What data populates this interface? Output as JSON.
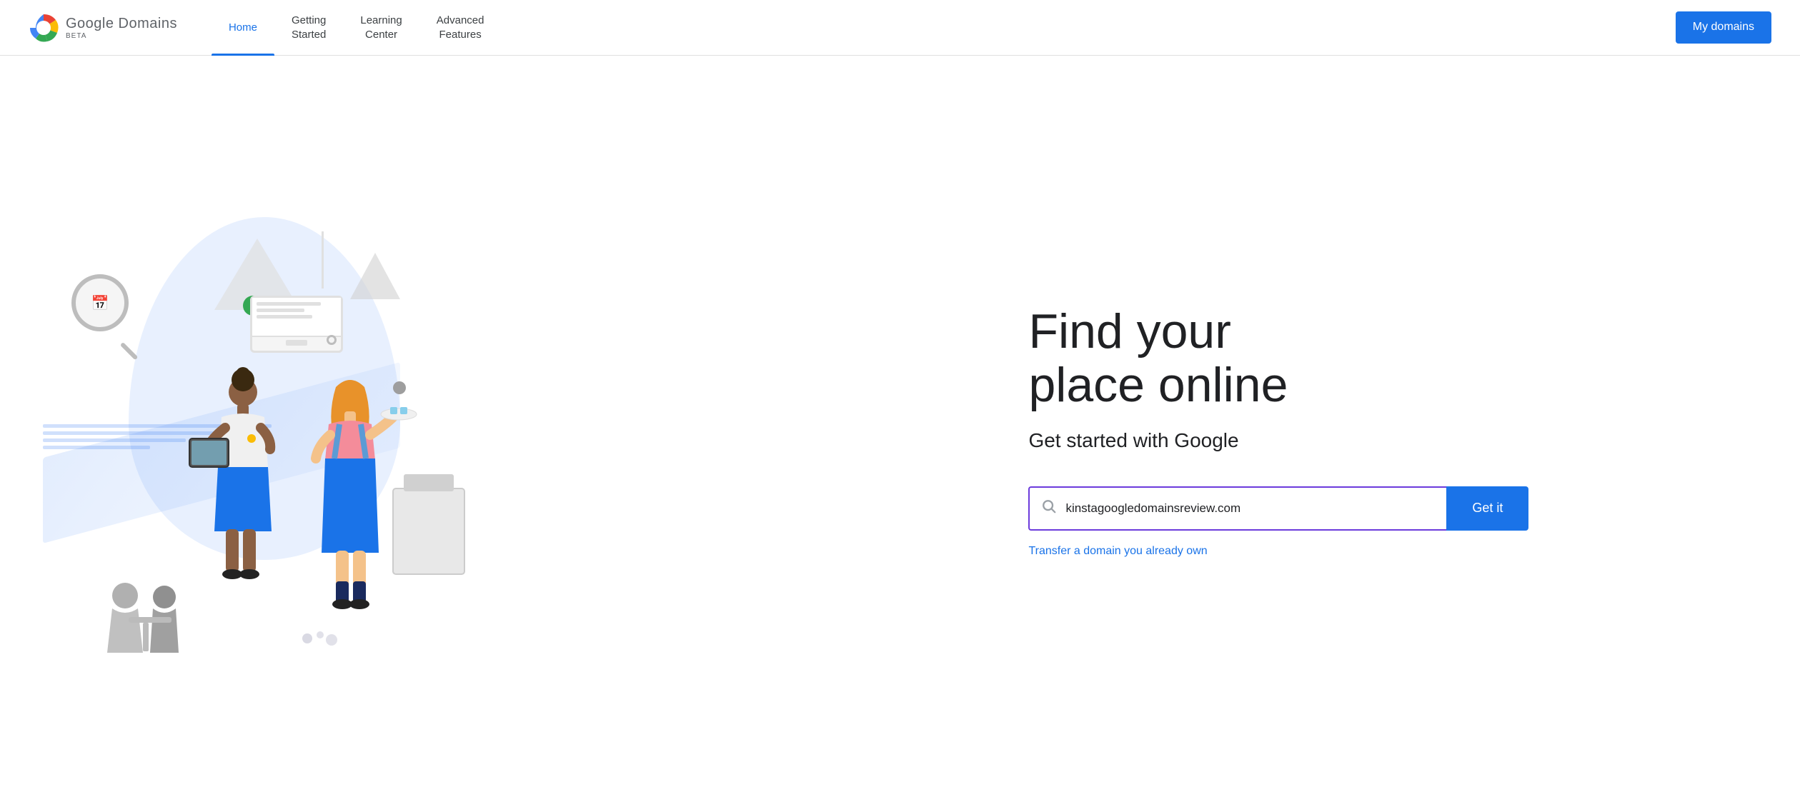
{
  "header": {
    "logo_name": "Google Domains",
    "logo_beta": "BETA",
    "nav": [
      {
        "id": "home",
        "label": "Home",
        "active": true
      },
      {
        "id": "getting-started",
        "label": "Getting\nStarted",
        "active": false
      },
      {
        "id": "learning-center",
        "label": "Learning\nCenter",
        "active": false
      },
      {
        "id": "advanced-features",
        "label": "Advanced\nFeatures",
        "active": false
      }
    ],
    "my_domains_btn": "My domains"
  },
  "hero": {
    "headline_line1": "Find your",
    "headline_line2": "place online",
    "subheadline": "Get started with Google",
    "search_placeholder": "kinstagoogledomainsreview.com",
    "search_value": "kinstagoogledomainsreview.com",
    "get_it_label": "Get it",
    "transfer_link": "Transfer a domain you already own"
  },
  "colors": {
    "accent_blue": "#1a73e8",
    "accent_purple": "#6c3bdc",
    "nav_active": "#1a73e8",
    "text_dark": "#202124",
    "text_gray": "#5f6368"
  }
}
